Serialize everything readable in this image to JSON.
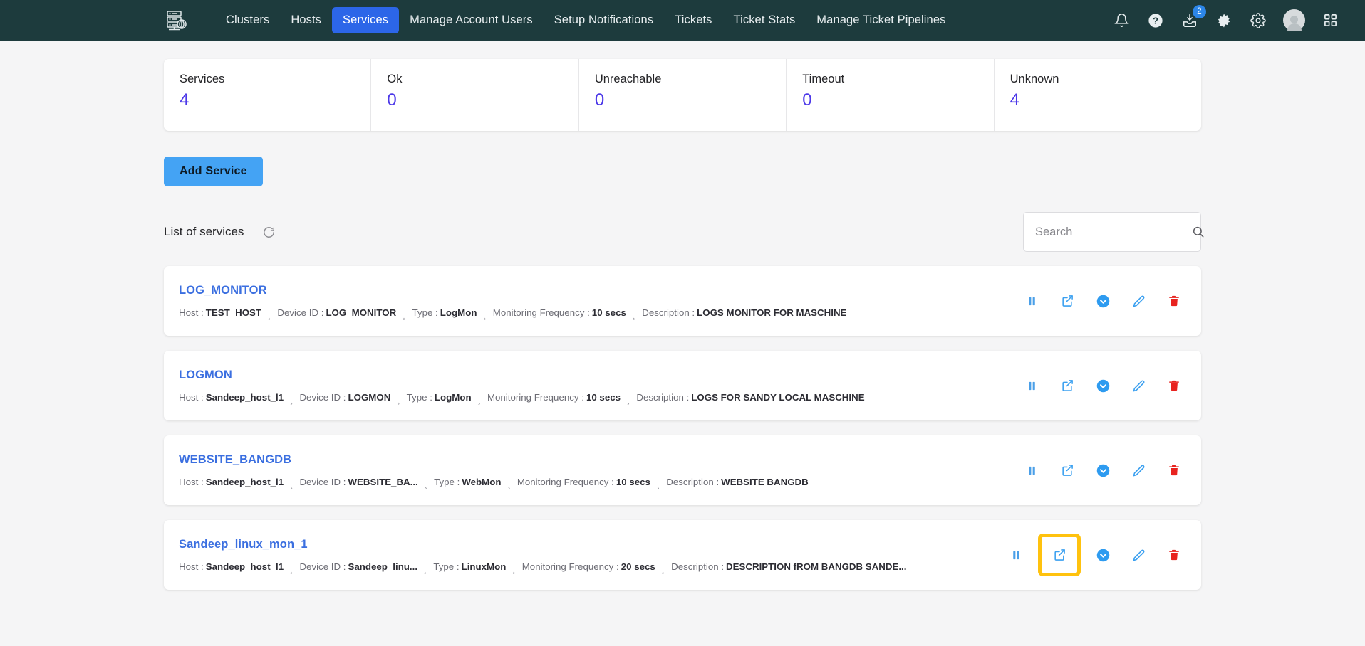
{
  "navbar": {
    "logo_icon": "server-rack-icon",
    "links": [
      {
        "label": "Clusters",
        "active": false
      },
      {
        "label": "Hosts",
        "active": false
      },
      {
        "label": "Services",
        "active": true
      },
      {
        "label": "Manage Account Users",
        "active": false
      },
      {
        "label": "Setup Notifications",
        "active": false
      },
      {
        "label": "Tickets",
        "active": false
      },
      {
        "label": "Ticket Stats",
        "active": false
      },
      {
        "label": "Manage Ticket Pipelines",
        "active": false
      }
    ],
    "icons": [
      {
        "name": "notifications-bell-icon"
      },
      {
        "name": "help-question-icon"
      },
      {
        "name": "inbox-download-icon",
        "badge": "2"
      },
      {
        "name": "dark-mode-toggle-icon"
      },
      {
        "name": "settings-gear-icon"
      },
      {
        "name": "user-avatar"
      },
      {
        "name": "apps-grid-icon"
      }
    ],
    "active_color": "#2c66e8",
    "background_color": "#1d3b3d"
  },
  "stats": [
    {
      "label": "Services",
      "value": "4"
    },
    {
      "label": "Ok",
      "value": "0"
    },
    {
      "label": "Unreachable",
      "value": "0"
    },
    {
      "label": "Timeout",
      "value": "0"
    },
    {
      "label": "Unknown",
      "value": "4"
    }
  ],
  "stat_value_color": "#4c38e8",
  "toolbar": {
    "add_service_label": "Add Service",
    "add_service_color": "#44a3f4",
    "list_title": "List of services",
    "refresh_icon": "refresh-icon"
  },
  "search": {
    "placeholder": "Search",
    "value": "",
    "icon": "search-icon"
  },
  "meta_labels": {
    "host": "Host :",
    "device_id": "Device ID :",
    "type": "Type :",
    "frequency": "Monitoring Frequency :",
    "description": "Description :",
    "separator": "¸"
  },
  "services": [
    {
      "name": "LOG_MONITOR",
      "host": "TEST_HOST",
      "device_id": "LOG_MONITOR",
      "type": "LogMon",
      "frequency": "10 secs",
      "description": "LOGS MONITOR FOR MASCHINE",
      "highlighted_action": null
    },
    {
      "name": "LOGMON",
      "host": "Sandeep_host_l1",
      "device_id": "LOGMON",
      "type": "LogMon",
      "frequency": "10 secs",
      "description": "LOGS FOR SANDY LOCAL MASCHINE",
      "highlighted_action": null
    },
    {
      "name": "WEBSITE_BANGDB",
      "host": "Sandeep_host_l1",
      "device_id": "WEBSITE_BA...",
      "type": "WebMon",
      "frequency": "10 secs",
      "description": "WEBSITE BANGDB",
      "highlighted_action": null
    },
    {
      "name": "Sandeep_linux_mon_1",
      "host": "Sandeep_host_l1",
      "device_id": "Sandeep_linu...",
      "type": "LinuxMon",
      "frequency": "20 secs",
      "description": "DESCRIPTION fROM BANGDB SANDE...",
      "highlighted_action": "open-in-new-icon"
    }
  ],
  "row_actions": [
    {
      "name": "pause-icon",
      "color": "#4a9fe8"
    },
    {
      "name": "open-in-new-icon",
      "color": "#3ba0f0"
    },
    {
      "name": "status-check-icon",
      "color": "#2e9bf0"
    },
    {
      "name": "edit-pencil-icon",
      "color": "#3ba0f0"
    },
    {
      "name": "delete-trash-icon",
      "color": "#e8231f"
    }
  ],
  "highlight_color": "#ffc20e"
}
